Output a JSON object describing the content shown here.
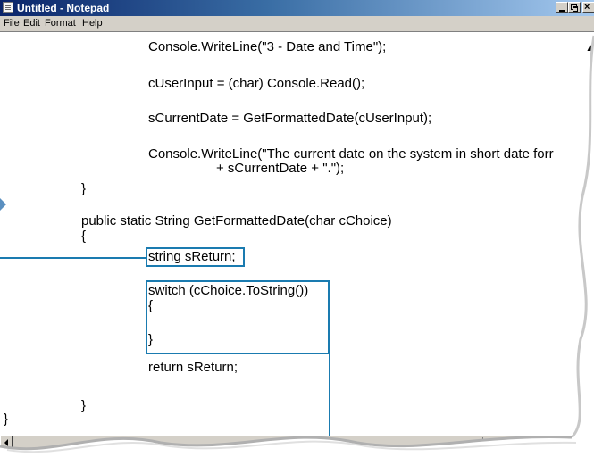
{
  "window": {
    "title": "Untitled - Notepad",
    "close_glyph": "×"
  },
  "menubar": {
    "items": [
      "File",
      "Edit",
      "Format",
      "Help"
    ]
  },
  "editor": {
    "lines": [
      "Console.WriteLine(\"3 - Date and Time\");",
      "cUserInput = (char) Console.Read();",
      "sCurrentDate = GetFormattedDate(cUserInput);",
      "Console.WriteLine(\"The current date on the system in short date forr",
      "+ sCurrentDate + \".\");",
      "}",
      "public static String GetFormattedDate(char cChoice)",
      "{",
      "string sReturn;",
      "switch (cChoice.ToString())",
      "{",
      "}",
      "return sReturn;",
      "}",
      "}"
    ]
  },
  "icons": {
    "window_icon": "notepad-icon",
    "minimize": "minimize-icon",
    "maximize": "restore-icon",
    "close": "close-icon",
    "scroll_up": "scroll-up-arrow-icon",
    "scroll_left": "scroll-left-arrow-icon",
    "callout_arrow": "callout-arrow-icon"
  },
  "colors": {
    "titlebar_start": "#0a246a",
    "titlebar_end": "#a6caf0",
    "callout": "#1a7bb0",
    "chrome": "#d4d0c8"
  }
}
